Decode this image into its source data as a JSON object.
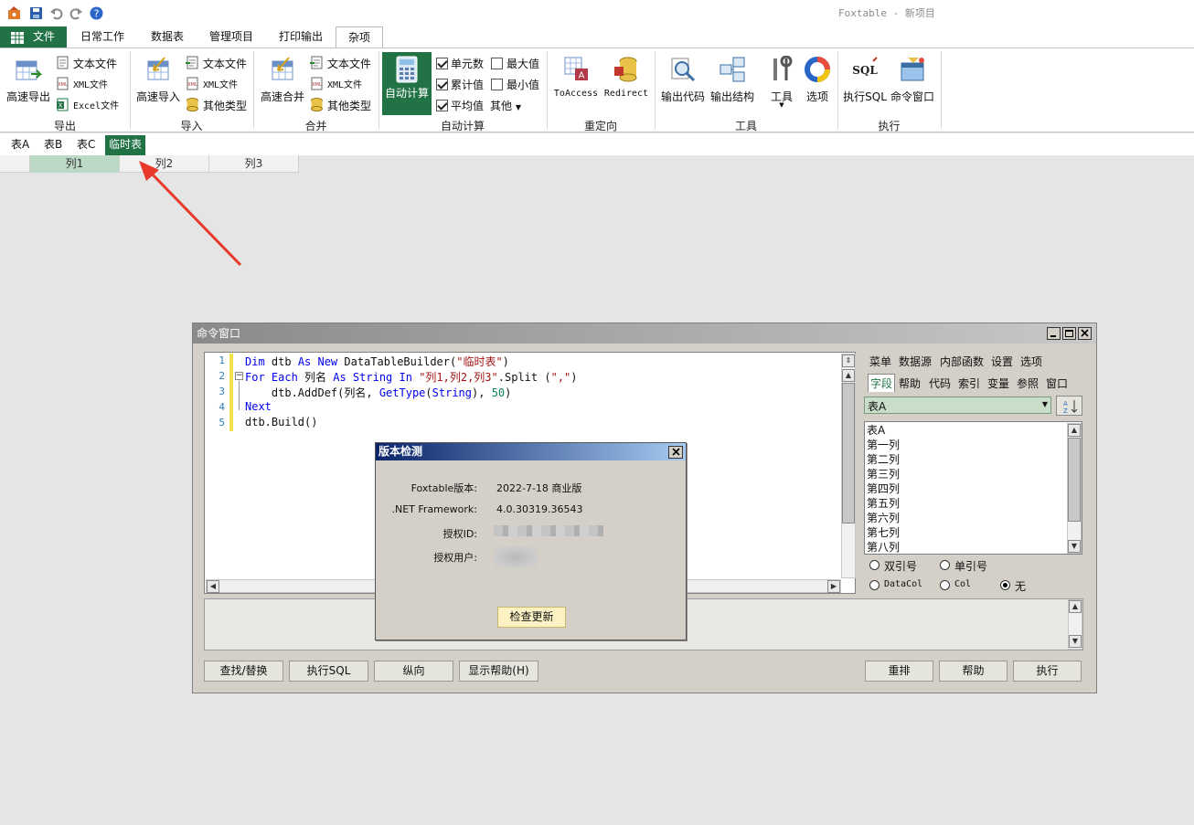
{
  "window": {
    "title": "Foxtable - 新项目"
  },
  "quick_access": [
    "app-icon",
    "save-icon",
    "undo-icon",
    "redo-icon",
    "help-icon"
  ],
  "ribbon_tabs": [
    "文件",
    "日常工作",
    "数据表",
    "管理项目",
    "打印输出",
    "杂项"
  ],
  "ribbon": {
    "export": {
      "big": "高速导出",
      "text": "文本文件",
      "xml": "XML文件",
      "excel": "Excel文件",
      "label": "导出"
    },
    "import": {
      "big": "高速导入",
      "text": "文本文件",
      "xml": "XML文件",
      "other": "其他类型",
      "label": "导入"
    },
    "merge": {
      "big": "高速合并",
      "text": "文本文件",
      "xml": "XML文件",
      "other": "其他类型",
      "label": "合并"
    },
    "autocalc": {
      "big": "自动计算",
      "cells": "单元数",
      "max": "最大值",
      "cumsum": "累计值",
      "min": "最小值",
      "avg": "平均值",
      "other": "其他",
      "label": "自动计算",
      "cells_checked": true,
      "cumsum_checked": true,
      "avg_checked": true,
      "max_checked": false,
      "min_checked": false
    },
    "redirect": {
      "to_access": "ToAccess",
      "redirect": "Redirect",
      "label": "重定向"
    },
    "tools": {
      "export_code": "输出代码",
      "export_struct": "输出结构",
      "tools": "工具",
      "options": "选项",
      "label": "工具"
    },
    "exec": {
      "sql": "执行SQL",
      "cmd": "命令窗口",
      "label": "执行"
    }
  },
  "sheet_tabs": [
    "表A",
    "表B",
    "表C",
    "临时表"
  ],
  "grid": {
    "columns": [
      "列1",
      "列2",
      "列3"
    ]
  },
  "cmd_window": {
    "title": "命令窗口",
    "line_numbers": [
      "1",
      "2",
      "3",
      "4",
      "5"
    ],
    "code": {
      "l1": {
        "kw1": "Dim",
        "t1": " dtb ",
        "kw2": "As New",
        "t2": " DataTableBuilder(",
        "s1": "\"临时表\"",
        "t3": ")"
      },
      "l2": {
        "kw1": "For Each",
        "t1": " 列名 ",
        "kw2": "As String In",
        "t2": " ",
        "s1": "\"列1,列2,列3\"",
        "t3": ".Split (",
        "s2": "\",\"",
        "t4": ")"
      },
      "l3": {
        "t1": "    dtb.AddDef(列名, ",
        "kw1": "GetType",
        "t2": "(",
        "kw2": "String",
        "t3": "), ",
        "n1": "50",
        "t4": ")"
      },
      "l4": {
        "kw1": "Next"
      },
      "l5": {
        "t1": "dtb.Build()"
      }
    },
    "menu_row1": [
      "菜单",
      "数据源",
      "内部函数",
      "设置",
      "选项"
    ],
    "menu_row2": [
      "字段",
      "帮助",
      "代码",
      "索引",
      "变量",
      "参照",
      "窗口"
    ],
    "table_select": "表A",
    "fields": [
      "表A",
      "第一列",
      "第二列",
      "第三列",
      "第四列",
      "第五列",
      "第六列",
      "第七列",
      "第八列"
    ],
    "radios": {
      "double_quote": "双引号",
      "single_quote": "单引号",
      "datacol": "DataCol",
      "col": "Col",
      "none": "无"
    },
    "buttons": {
      "find": "查找/替换",
      "exec_sql": "执行SQL",
      "vertical": "纵向",
      "show_help": "显示帮助(H)",
      "rearrange": "重排",
      "help": "帮助",
      "run": "执行"
    }
  },
  "version_dialog": {
    "title": "版本检测",
    "labels": {
      "version": "Foxtable版本:",
      "framework": ".NET Framework:",
      "license_id": "授权ID:",
      "license_user": "授权用户:"
    },
    "values": {
      "version": "2022-7-18  商业版",
      "framework": "4.0.30319.36543"
    },
    "check_button": "检查更新"
  },
  "colors": {
    "accent": "#217346",
    "arrow": "#e8392a",
    "dialog_title": "#0a246a"
  }
}
